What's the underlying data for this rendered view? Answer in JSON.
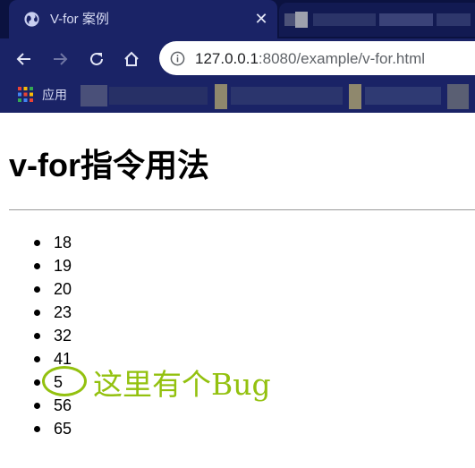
{
  "browser": {
    "tab_title": "V-for 案例",
    "tab_close_glyph": "✕",
    "url_host": "127.0.0.1",
    "url_rest": ":8080/example/v-for.html",
    "bookmark_label": "应用",
    "icons": [
      "globe-icon",
      "close-icon",
      "back-icon",
      "forward-icon",
      "reload-icon",
      "home-icon",
      "info-icon",
      "apps-grid-icon"
    ],
    "colors": {
      "tabbar": "#0b1240",
      "toolbar": "#1a2366",
      "omnibox": "#ffffff"
    }
  },
  "page": {
    "title": "v-for指令用法",
    "ages": [
      "18",
      "19",
      "20",
      "23",
      "32",
      "41",
      "5",
      "56",
      "65"
    ],
    "annotation": {
      "text": "这里有个Bug",
      "color": "#93c10f"
    }
  }
}
